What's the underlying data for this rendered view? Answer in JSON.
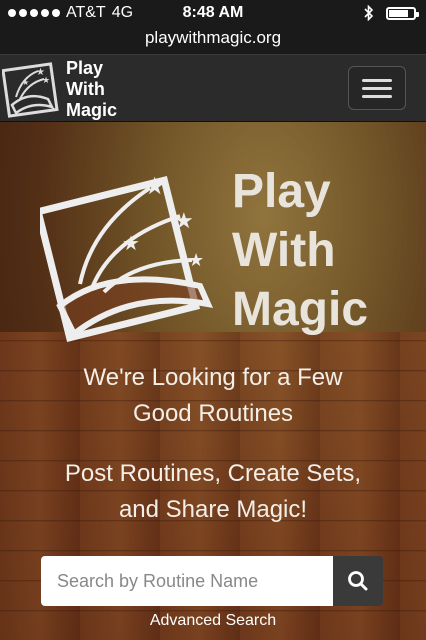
{
  "status": {
    "carrier": "AT&T",
    "network": "4G",
    "time": "8:48 AM",
    "battery_level": 0.85
  },
  "browser": {
    "url": "playwithmagic.org"
  },
  "navbar": {
    "brand_line1": "Play",
    "brand_line2": "With",
    "brand_line3": "Magic",
    "menu_icon": "hamburger-icon"
  },
  "hero": {
    "title_line1": "Play",
    "title_line2": "With",
    "title_line3": "Magic",
    "tagline1_line1": "We're Looking for a Few",
    "tagline1_line2": "Good Routines",
    "tagline2_line1": "Post Routines, Create Sets,",
    "tagline2_line2": "and Share Magic!"
  },
  "search": {
    "placeholder": "Search by Routine Name",
    "value": "",
    "button_icon": "search-icon"
  },
  "advanced_search_label": "Advanced Search",
  "colors": {
    "navbar": "#2b2b2b",
    "search_button": "#3a3a3a",
    "hero_text": "#e8e4dc"
  }
}
